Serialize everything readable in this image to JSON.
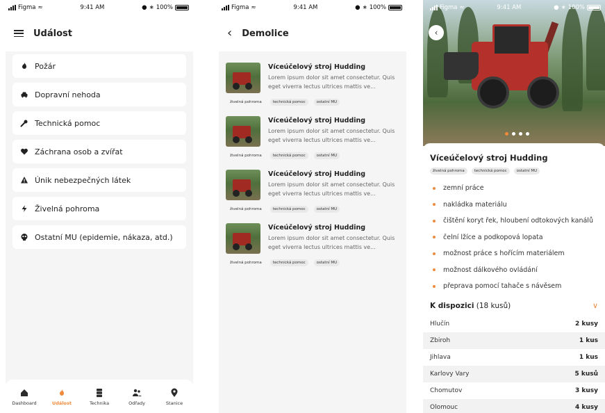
{
  "status": {
    "carrier": "Figma",
    "time": "9:41 AM",
    "battery": "100%"
  },
  "screen1": {
    "title": "Událost",
    "categories": [
      {
        "label": "Požár",
        "icon": "fire-icon"
      },
      {
        "label": "Dopravní nehoda",
        "icon": "car-icon"
      },
      {
        "label": "Technická pomoc",
        "icon": "wrench-icon"
      },
      {
        "label": "Záchrana osob a zvířat",
        "icon": "heart-icon"
      },
      {
        "label": "Únik nebezpečných látek",
        "icon": "warning-icon"
      },
      {
        "label": "Živelná pohroma",
        "icon": "bolt-icon"
      },
      {
        "label": "Ostatní MU (epidemie, nákaza, atd.)",
        "icon": "skull-icon"
      }
    ],
    "nav": [
      {
        "label": "Dashboard",
        "icon": "home-icon",
        "active": false
      },
      {
        "label": "Událost",
        "icon": "fire-icon",
        "active": true
      },
      {
        "label": "Technika",
        "icon": "server-icon",
        "active": false
      },
      {
        "label": "Odřady",
        "icon": "users-icon",
        "active": false
      },
      {
        "label": "Stanice",
        "icon": "map-pin-icon",
        "active": false
      }
    ]
  },
  "screen2": {
    "title": "Demolice",
    "items": [
      {
        "title": "Víceúčelový stroj Hudding",
        "desc": "Lorem ipsum dolor sit amet consectetur. Quis eget viverra lectus ultrices mattis ve...",
        "tags": [
          "živelná pohroma",
          "technická pomoc",
          "ostatní MU"
        ]
      },
      {
        "title": "Víceúčelový stroj Hudding",
        "desc": "Lorem ipsum dolor sit amet consectetur. Quis eget viverra lectus ultrices mattis ve...",
        "tags": [
          "živelná pohroma",
          "technická pomoc",
          "ostatní MU"
        ]
      },
      {
        "title": "Víceúčelový stroj Hudding",
        "desc": "Lorem ipsum dolor sit amet consectetur. Quis eget viverra lectus ultrices mattis ve...",
        "tags": [
          "živelná pohroma",
          "technická pomoc",
          "ostatní MU"
        ]
      },
      {
        "title": "Víceúčelový stroj Hudding",
        "desc": "Lorem ipsum dolor sit amet consectetur. Quis eget viverra lectus ultrices mattis ve...",
        "tags": [
          "živelná pohroma",
          "technická pomoc",
          "ostatní MU"
        ]
      }
    ]
  },
  "screen3": {
    "title": "Víceúčelový stroj Hudding",
    "tags": [
      "živelná pohroma",
      "technická pomoc",
      "ostatní MU"
    ],
    "features": [
      "zemní práce",
      "nakládka materiálu",
      "čištění koryt řek, hloubení odtokových kanálů",
      "čelní lžíce a podkopová lopata",
      "možnost práce s hořícím materiálem",
      "možnost dálkového ovládání",
      "přeprava pomocí tahače s návěsem"
    ],
    "availability": {
      "label": "K dispozici",
      "count": "(18 kusů)",
      "rows": [
        {
          "place": "Hlučín",
          "qty": "2 kusy"
        },
        {
          "place": "Zbiroh",
          "qty": "1 kus"
        },
        {
          "place": "Jihlava",
          "qty": "1 kus"
        },
        {
          "place": "Karlovy Vary",
          "qty": "5 kusů"
        },
        {
          "place": "Chomutov",
          "qty": "3 kusy"
        },
        {
          "place": "Olomouc",
          "qty": "4 kusy"
        }
      ]
    },
    "carousel": {
      "count": 4,
      "active": 0
    }
  },
  "colors": {
    "accent": "#f08a3c",
    "background": "#f5f5f5",
    "card": "#ffffff"
  }
}
